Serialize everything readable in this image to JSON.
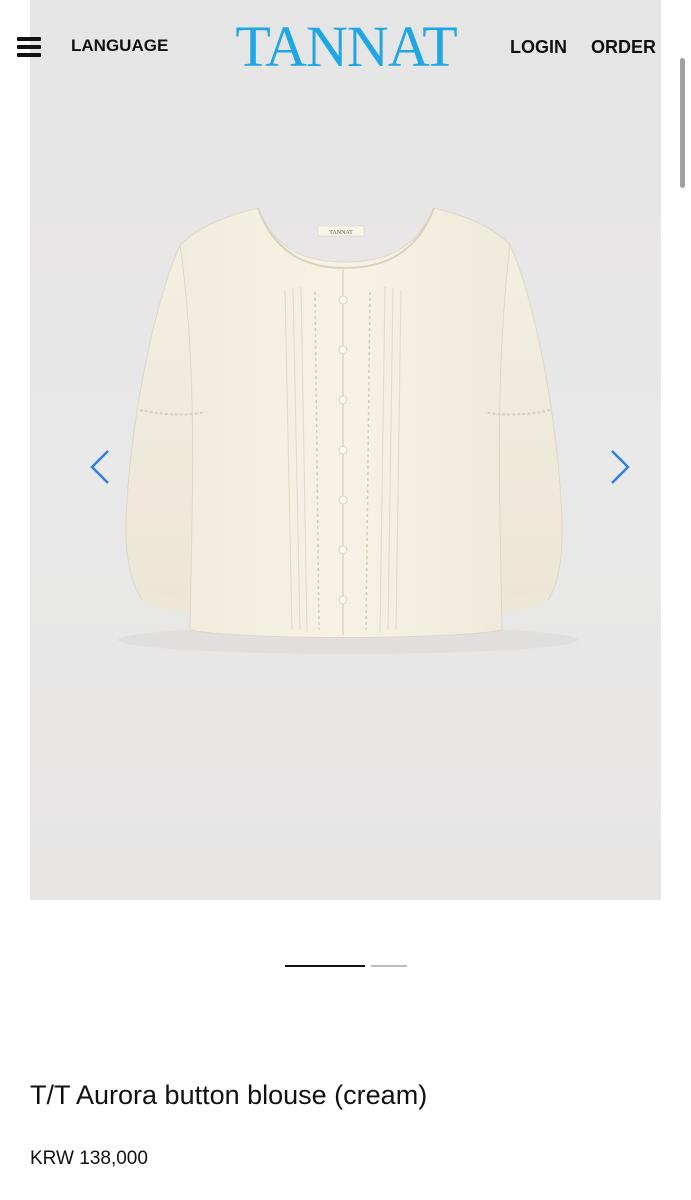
{
  "header": {
    "menu_icon": "hamburger-menu-icon",
    "language_label": "LANGUAGE",
    "logo_text": "TANNAT",
    "login_label": "LOGIN",
    "order_label": "ORDER",
    "brand_color": "#1ea7e4"
  },
  "gallery": {
    "prev_icon": "chevron-left-icon",
    "next_icon": "chevron-right-icon",
    "label_text": "TANNAT",
    "slide_count": 2,
    "active_slide": 1,
    "arrow_color": "#2f7fd8"
  },
  "product": {
    "name": "T/T Aurora button blouse (cream)",
    "price": "KRW 138,000"
  }
}
